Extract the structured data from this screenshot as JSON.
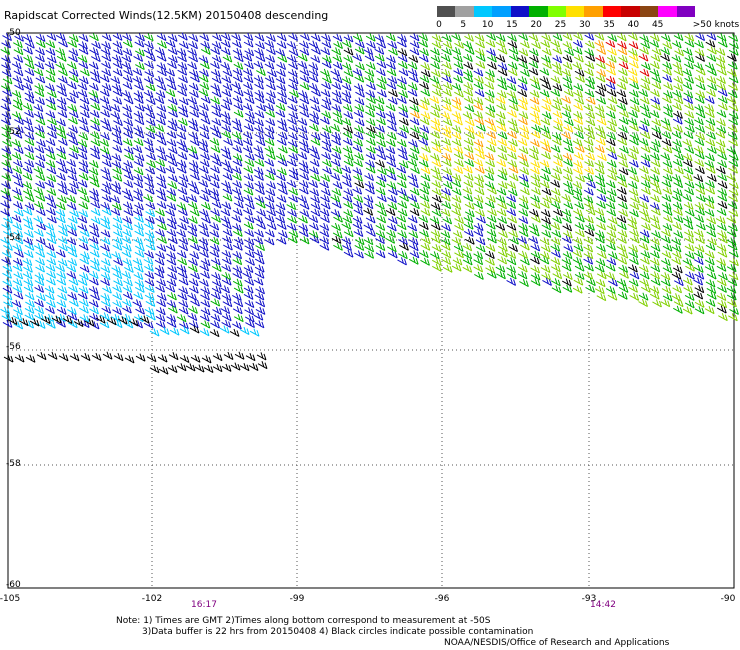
{
  "title": "Rapidscat Corrected Winds(12.5KM) 20150408 descending",
  "colorbar": {
    "labels": [
      "0",
      "5",
      "10",
      "15",
      "20",
      "25",
      "30",
      "35",
      "40",
      "45",
      ">50 knots"
    ],
    "colors": [
      "#505050",
      "#a0a0a0",
      "#00c8ff",
      "#00a0ff",
      "#1010c8",
      "#00b000",
      "#80ff00",
      "#ffe000",
      "#ffa000",
      "#ff0000",
      "#c80000",
      "#8b4513",
      "#ff00ff",
      "#8000c0"
    ]
  },
  "lat_labels": [
    "-50",
    "-52",
    "-54",
    "-56",
    "-58",
    "-60"
  ],
  "lon_labels": [
    "-105",
    "-102",
    "-99",
    "-96",
    "-93",
    "-90"
  ],
  "time_labels": [
    "16:17",
    "14:42"
  ],
  "notes": {
    "line1": "Note: 1) Times are GMT 2)Times along bottom correspond to measurement at -50S",
    "line2": "3)Data buffer is 22 hrs from 20150408 4) Black circles indicate possible contamination",
    "line3": "NOAA/NESDIS/Office of Research and Applications"
  },
  "map": {
    "lon_range": [
      -105,
      -90
    ],
    "lat_range": [
      -60,
      -50
    ],
    "grid": "dotted",
    "wind_speed_colors": {
      "cyan": "#00c8ff",
      "blue": "#1010c8",
      "green": "#00b000",
      "light_green": "#80d000",
      "yellow": "#ffe000",
      "orange": "#ffa000",
      "red": "#e00000",
      "black": "#000000"
    }
  }
}
